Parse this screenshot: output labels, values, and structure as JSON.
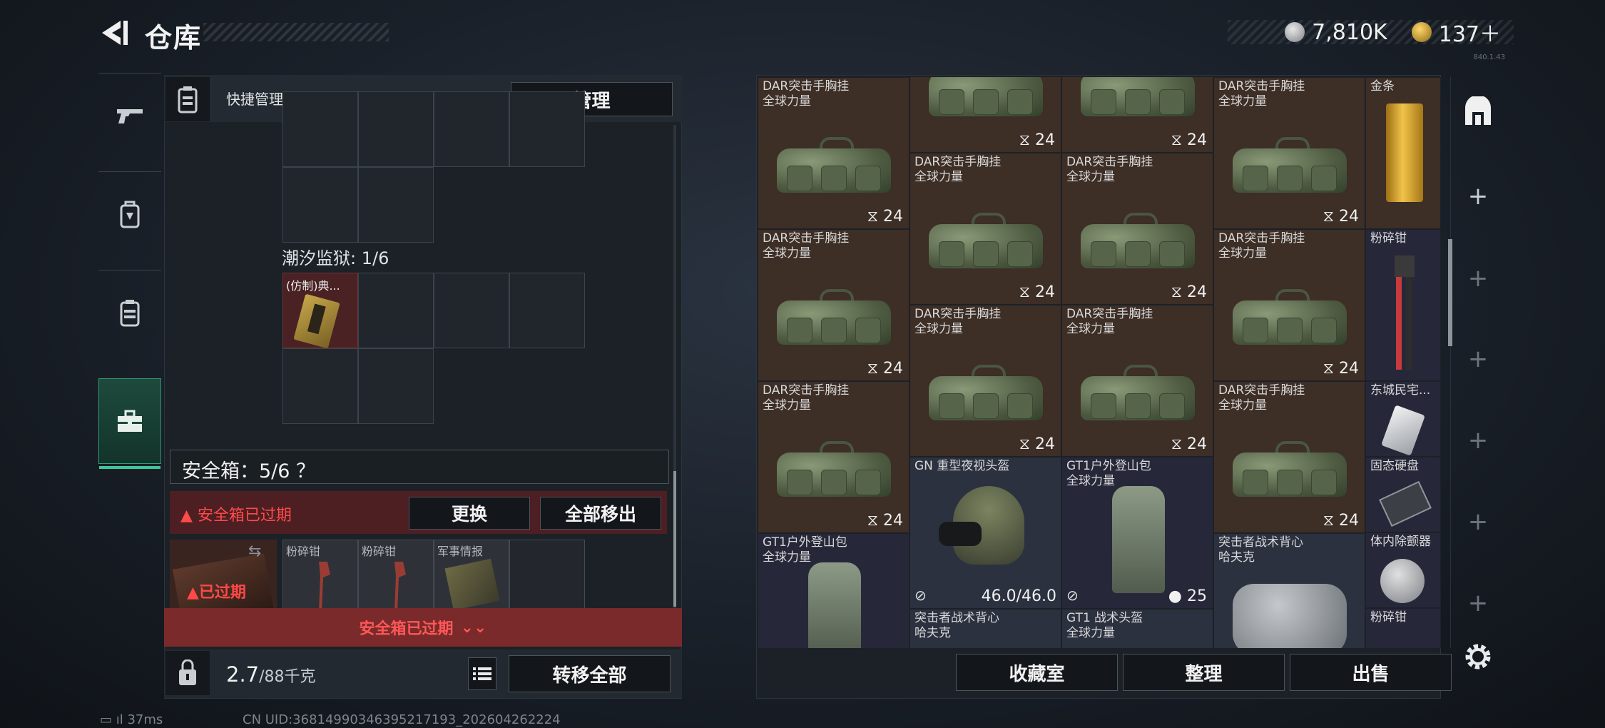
{
  "header": {
    "title": "仓库",
    "currency_1": "7,810K",
    "currency_2": "137＋",
    "version": "840.1.43"
  },
  "left_nav": [
    "gun-icon",
    "backpack-icon",
    "vest-icon",
    "toolbox-icon"
  ],
  "key_panel": {
    "label": "快捷管理门卡",
    "manage_button": "管理",
    "prison_label": "潮汐监狱: 1/6",
    "card_name": "(仿制)典..."
  },
  "safe_box": {
    "label": "安全箱：5/6 ？",
    "expired_warning": "安全箱已过期",
    "replace_button": "更换",
    "move_all_button": "全部移出",
    "expired_badge": "已过期",
    "slots": [
      "粉碎钳",
      "粉碎钳",
      "军事情报"
    ],
    "footer": "安全箱已过期"
  },
  "bottom_left": {
    "weight": "2.7",
    "weight_max": "/88千克",
    "transfer_button": "转移全部"
  },
  "inventory": {
    "dar_name_1": "DAR突击手胸挂",
    "dar_name_2": "全球力量",
    "count": "24",
    "gold_bar": "金条",
    "crusher": "粉碎钳",
    "dongcheng": "东城民宅...",
    "ssd": "固态硬盘",
    "implant": "体内除颤器",
    "nv_helmet": "GN 重型夜视头盔",
    "nv_durability": "46.0/46.0",
    "gt1_bag_1": "GT1户外登山包",
    "gt1_bag_2": "全球力量",
    "gt1_count": "25",
    "raider_vest_1": "突击者战术背心",
    "raider_vest_2": "哈夫克",
    "gt1_helmet_1": "GT1 战术头盔",
    "gt1_helmet_2": "全球力量"
  },
  "bottom_right": {
    "collection_button": "收藏室",
    "sort_button": "整理",
    "sell_button": "出售"
  },
  "status_bar": {
    "ping": "37ms",
    "uid": "CN UID:3681499034639521719​3_202604262224"
  }
}
